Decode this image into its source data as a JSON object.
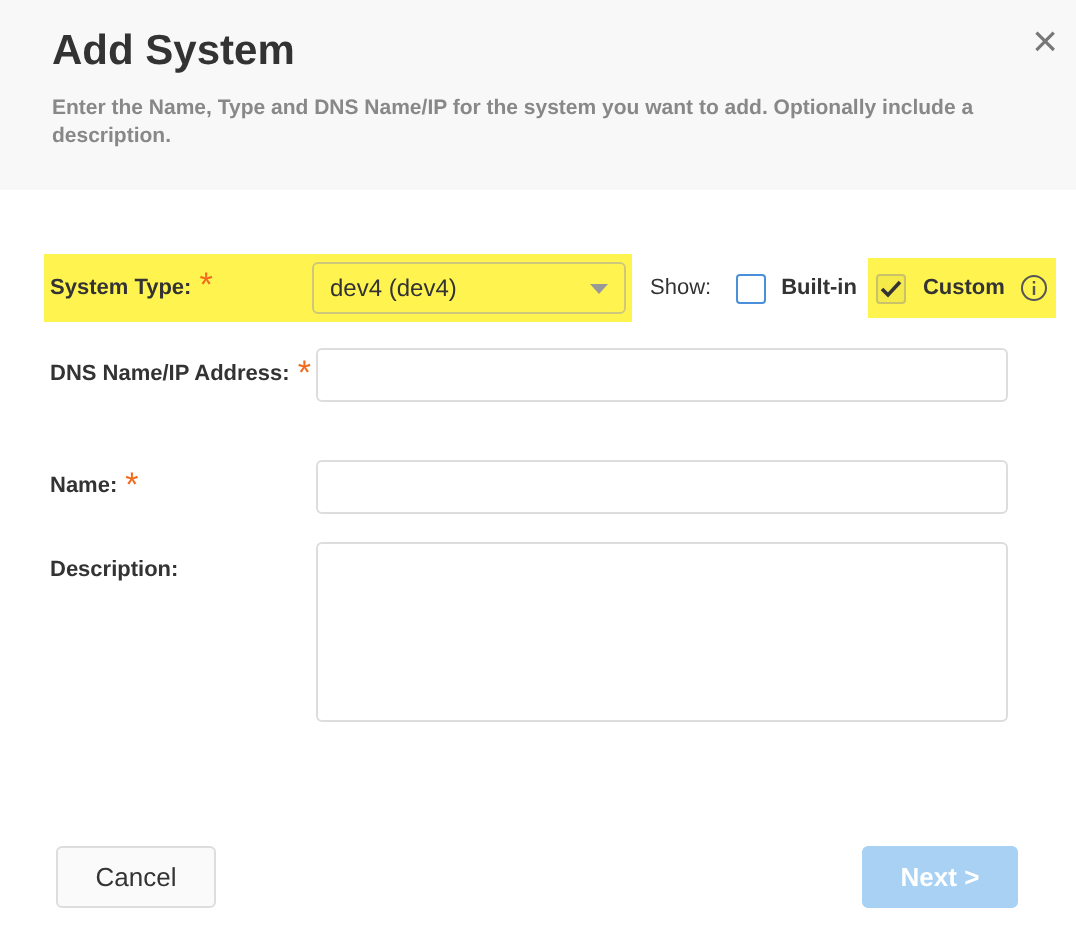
{
  "dialog": {
    "title": "Add System",
    "close": "×",
    "description": "Enter the Name, Type and DNS Name/IP for the system you want to add. Optionally include a description."
  },
  "system_type": {
    "label": "System Type:",
    "required_mark": "*",
    "highlighted": true,
    "value": "dev4 (dev4)"
  },
  "show": {
    "label": "Show:",
    "options": [
      {
        "label": "Built-in",
        "checked": false,
        "highlighted": false
      },
      {
        "label": "Custom",
        "checked": true,
        "highlighted": true
      }
    ]
  },
  "fields": [
    {
      "kind": "input",
      "label": "DNS Name/IP Address:",
      "required_mark": "*"
    },
    {
      "kind": "input",
      "label": "Name:",
      "required_mark": "*"
    },
    {
      "kind": "textarea",
      "label": "Description:"
    }
  ],
  "buttons": [
    {
      "label": "Cancel",
      "disabled": false
    },
    {
      "label": "Next >",
      "disabled": true
    }
  ]
}
